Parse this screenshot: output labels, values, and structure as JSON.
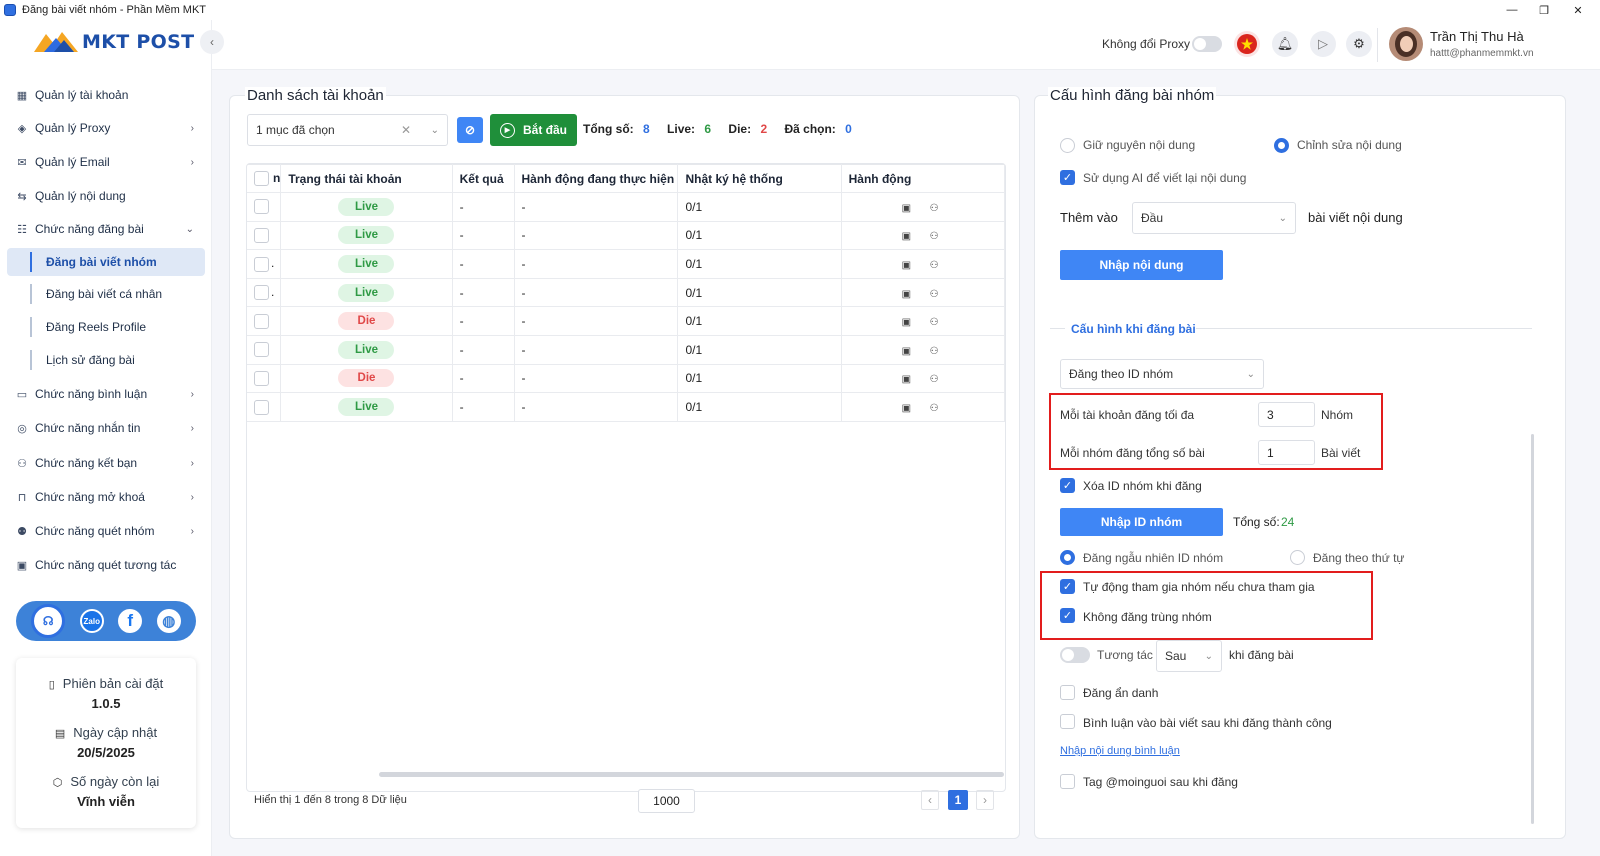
{
  "window": {
    "title": "Đăng bài viết nhóm - Phần Mềm MKT",
    "controls": [
      "—",
      "❐",
      "✕"
    ]
  },
  "brand": {
    "name": "MKT POST"
  },
  "sidebar": {
    "items": [
      {
        "label": "Quản lý tài khoản",
        "icon": "grid-icon",
        "chevron": ""
      },
      {
        "label": "Quản lý Proxy",
        "icon": "layers-icon",
        "chevron": "›"
      },
      {
        "label": "Quản lý Email",
        "icon": "mail-icon",
        "chevron": "›"
      },
      {
        "label": "Quản lý nội dung",
        "icon": "content-icon",
        "chevron": ""
      },
      {
        "label": "Chức năng đăng bài",
        "icon": "post-icon",
        "chevron": "⌄"
      }
    ],
    "subitems": [
      "Đăng bài viết nhóm",
      "Đăng bài viết cá nhân",
      "Đăng Reels Profile",
      "Lịch sử đăng bài"
    ],
    "items2": [
      {
        "label": "Chức năng bình luận",
        "icon": "comment-icon",
        "chevron": "›"
      },
      {
        "label": "Chức năng nhắn tin",
        "icon": "chat-icon",
        "chevron": "›"
      },
      {
        "label": "Chức năng kết bạn",
        "icon": "add-friend-icon",
        "chevron": "›"
      },
      {
        "label": "Chức năng mở khoá",
        "icon": "lock-icon",
        "chevron": "›"
      },
      {
        "label": "Chức năng quét nhóm",
        "icon": "group-icon",
        "chevron": "›"
      },
      {
        "label": "Chức năng quét tương tác",
        "icon": "scan-icon",
        "chevron": ""
      }
    ],
    "social": [
      "support-icon",
      "zalo-icon",
      "facebook-icon",
      "globe-icon"
    ],
    "info": {
      "version_label": "Phiên bản cài đặt",
      "version": "1.0.5",
      "update_label": "Ngày cập nhật",
      "update": "20/5/2025",
      "days_label": "Số ngày còn lại",
      "days": "Vĩnh viễn"
    }
  },
  "header": {
    "proxy_label": "Không đổi Proxy",
    "proxy_toggle_on": false,
    "user_name": "Trần Thị Thu Hà",
    "user_email": "hattt@phanmemmkt.vn"
  },
  "accounts": {
    "title": "Danh sách tài khoản",
    "selection": "1 mục đã chọn",
    "start_label": "Bắt đầu",
    "stats": {
      "total_label": "Tổng số:",
      "total": "8",
      "live_label": "Live:",
      "live": "6",
      "die_label": "Die:",
      "die": "2",
      "selected_label": "Đã chọn:",
      "selected": "0"
    },
    "columns": [
      "n",
      "Trạng thái tài khoản",
      "Kết quả",
      "Hành động đang thực hiện",
      "Nhật ký hệ thống",
      "Hành động"
    ],
    "rows": [
      {
        "uid": "",
        "status": "Live",
        "result": "-",
        "action": "-",
        "log": "0/1"
      },
      {
        "uid": "",
        "status": "Live",
        "result": "-",
        "action": "-",
        "log": "0/1"
      },
      {
        "uid": ".",
        "status": "Live",
        "result": "-",
        "action": "-",
        "log": "0/1"
      },
      {
        "uid": ".",
        "status": "Live",
        "result": "-",
        "action": "-",
        "log": "0/1"
      },
      {
        "uid": "",
        "status": "Die",
        "result": "-",
        "action": "-",
        "log": "0/1"
      },
      {
        "uid": "",
        "status": "Live",
        "result": "-",
        "action": "-",
        "log": "0/1"
      },
      {
        "uid": "",
        "status": "Die",
        "result": "-",
        "action": "-",
        "log": "0/1"
      },
      {
        "uid": "",
        "status": "Live",
        "result": "-",
        "action": "-",
        "log": "0/1"
      }
    ],
    "footer": "Hiển thị 1 đến 8 trong 8 Dữ liệu",
    "page_size": "1000",
    "page": "1",
    "prev": "‹",
    "next": "›"
  },
  "config": {
    "title": "Cấu hình đăng bài nhóm",
    "keep_content": "Giữ nguyên nội dung",
    "edit_content": "Chỉnh sửa nội dung",
    "use_ai": "Sử dụng AI để viết lại nội dung",
    "add_to_label": "Thêm vào",
    "add_to_value": "Đầu",
    "add_to_suffix": "bài viết nội dung",
    "import_content": "Nhập nội dung",
    "section_title": "Cấu hình khi đăng bài",
    "post_mode": "Đăng theo ID nhóm",
    "max_per_account_label": "Mỗi tài khoản đăng tối đa",
    "max_per_account": "3",
    "max_per_account_unit": "Nhóm",
    "posts_per_group_label": "Mỗi nhóm đăng tổng số bài",
    "posts_per_group": "1",
    "posts_per_group_unit": "Bài viết",
    "delete_id": "Xóa ID nhóm khi đăng",
    "import_id": "Nhập ID nhóm",
    "total_label": "Tổng số:",
    "total": "24",
    "random_order": "Đăng ngẫu nhiên ID nhóm",
    "sequential_order": "Đăng theo thứ tự",
    "auto_join": "Tự động tham gia nhóm nếu chưa tham gia",
    "no_duplicate": "Không đăng trùng nhóm",
    "interact_label": "Tương tác",
    "interact_value": "Sau",
    "interact_suffix": "khi đăng bài",
    "anonymous": "Đăng ẩn danh",
    "comment_after": "Bình luận vào bài viết sau khi đăng thành công",
    "comment_link": "Nhập nội dung bình luận",
    "tag_all": "Tag @moinguoi sau khi đăng"
  },
  "colors": {
    "primary": "#3f86f5",
    "start_button": "#1f8f3a",
    "live": "#2f9a45",
    "die": "#e04848",
    "highlight_box": "#e21d1d"
  }
}
